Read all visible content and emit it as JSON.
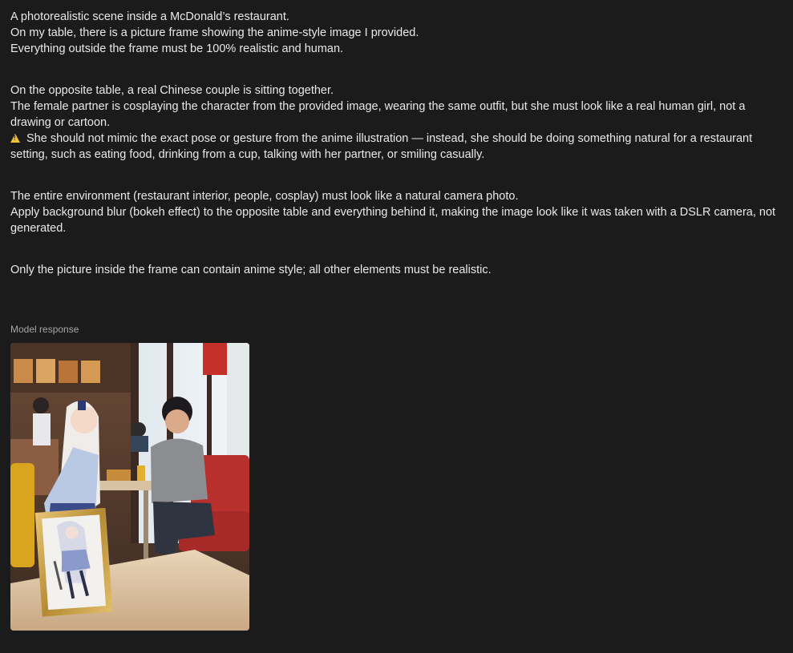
{
  "prompt": {
    "paragraphs": [
      {
        "lines": [
          "A photorealistic scene inside a McDonald’s restaurant.",
          "On my table, there is a picture frame showing the anime-style image I provided.",
          "Everything outside the frame must be 100% realistic and human."
        ]
      },
      {
        "lines": [
          "On the opposite table, a real Chinese couple is sitting together.",
          "The female partner is cosplaying the character from the provided image, wearing the same outfit, but she must look like a real human girl, not a drawing or cartoon."
        ],
        "warning_line": "She should not mimic the exact pose or gesture from the anime illustration — instead, she should be doing something natural for a restaurant setting, such as eating food, drinking from a cup, talking with her partner, or smiling casually."
      },
      {
        "lines": [
          "The entire environment (restaurant interior, people, cosplay) must look like a natural camera photo.",
          "Apply background blur (bokeh effect) to the opposite table and everything behind it, making the image look like it was taken with a DSLR camera, not generated."
        ]
      },
      {
        "lines": [
          "Only the picture inside the frame can contain anime style; all other elements must be realistic."
        ]
      }
    ]
  },
  "response": {
    "label": "Model response",
    "image_alt": "Generated photo of a couple in a McDonald's with an anime picture frame on the table"
  },
  "colors": {
    "background": "#1b1b1b",
    "text": "#e9e9e9",
    "label": "#a8a8a8",
    "warning": "#f1c232"
  }
}
